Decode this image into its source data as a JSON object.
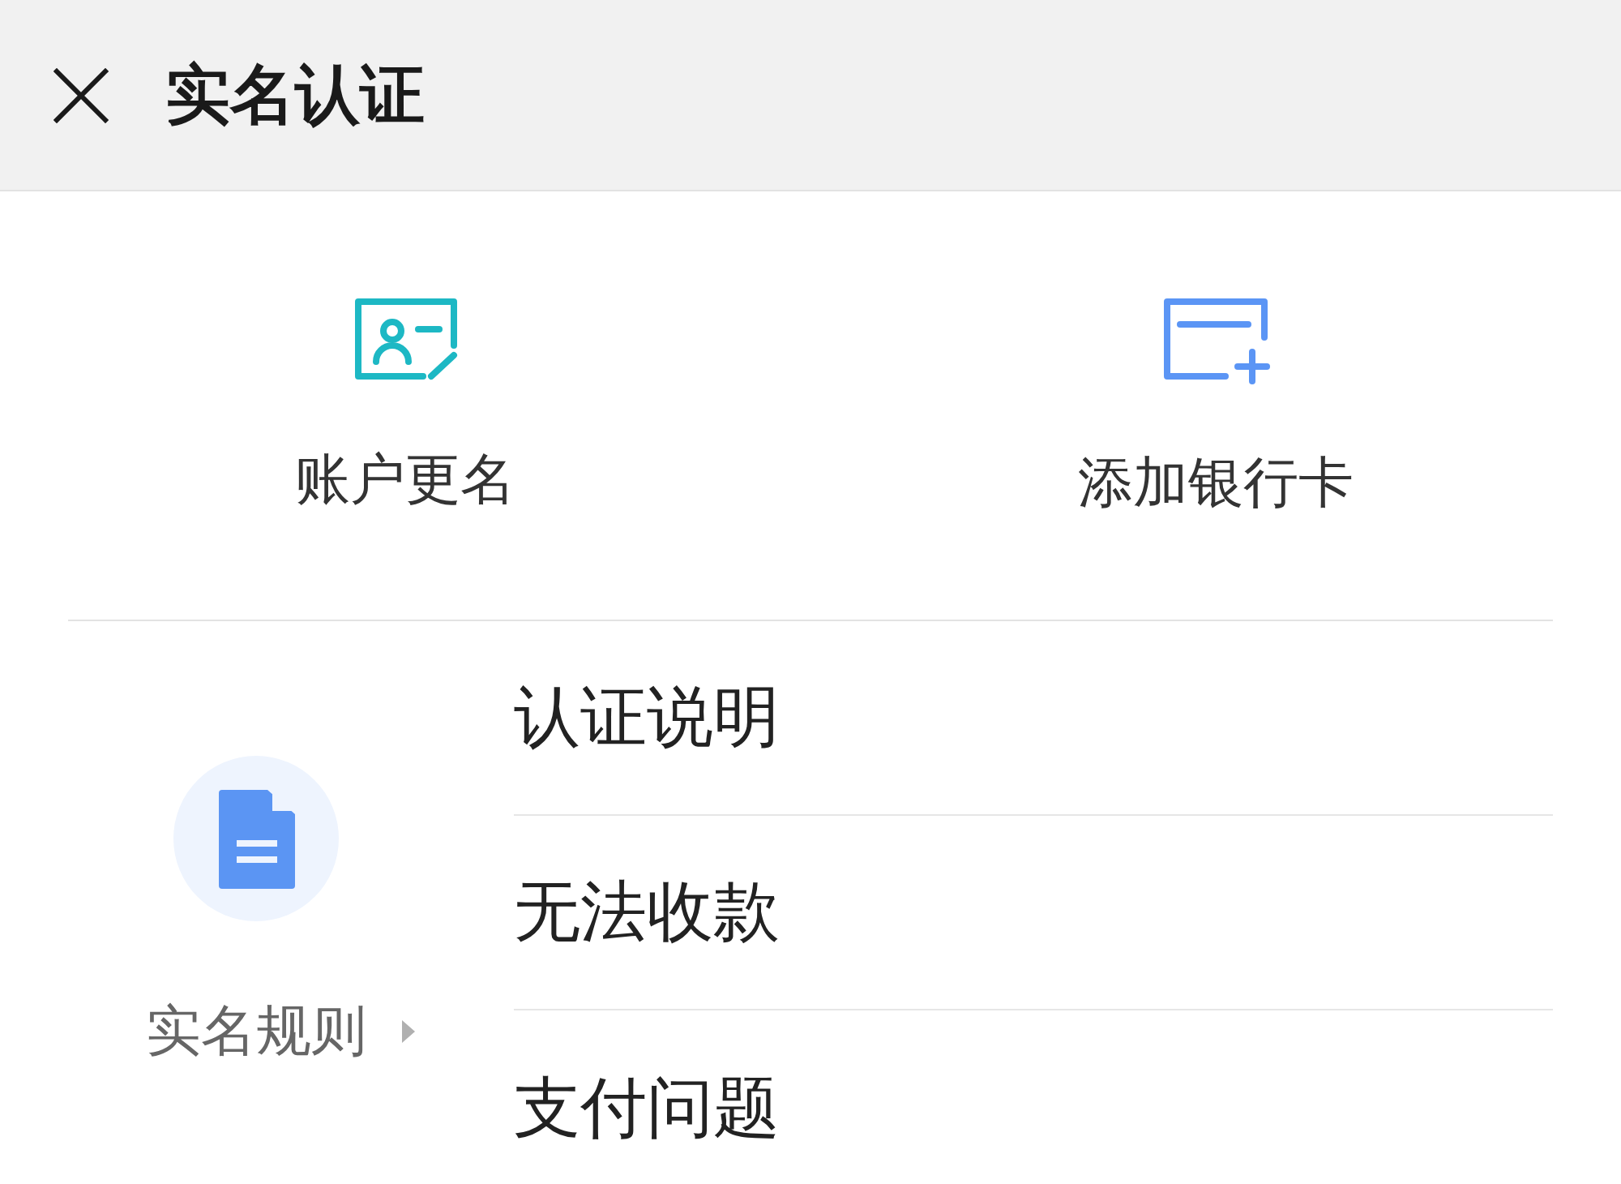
{
  "header": {
    "title": "实名认证"
  },
  "actions": [
    {
      "kind": "rename",
      "label": "账户更名"
    },
    {
      "kind": "add-card",
      "label": "添加银行卡"
    }
  ],
  "rules": {
    "label": "实名规则"
  },
  "help_items": [
    {
      "label": "认证说明"
    },
    {
      "label": "无法收款"
    },
    {
      "label": "支付问题"
    }
  ]
}
